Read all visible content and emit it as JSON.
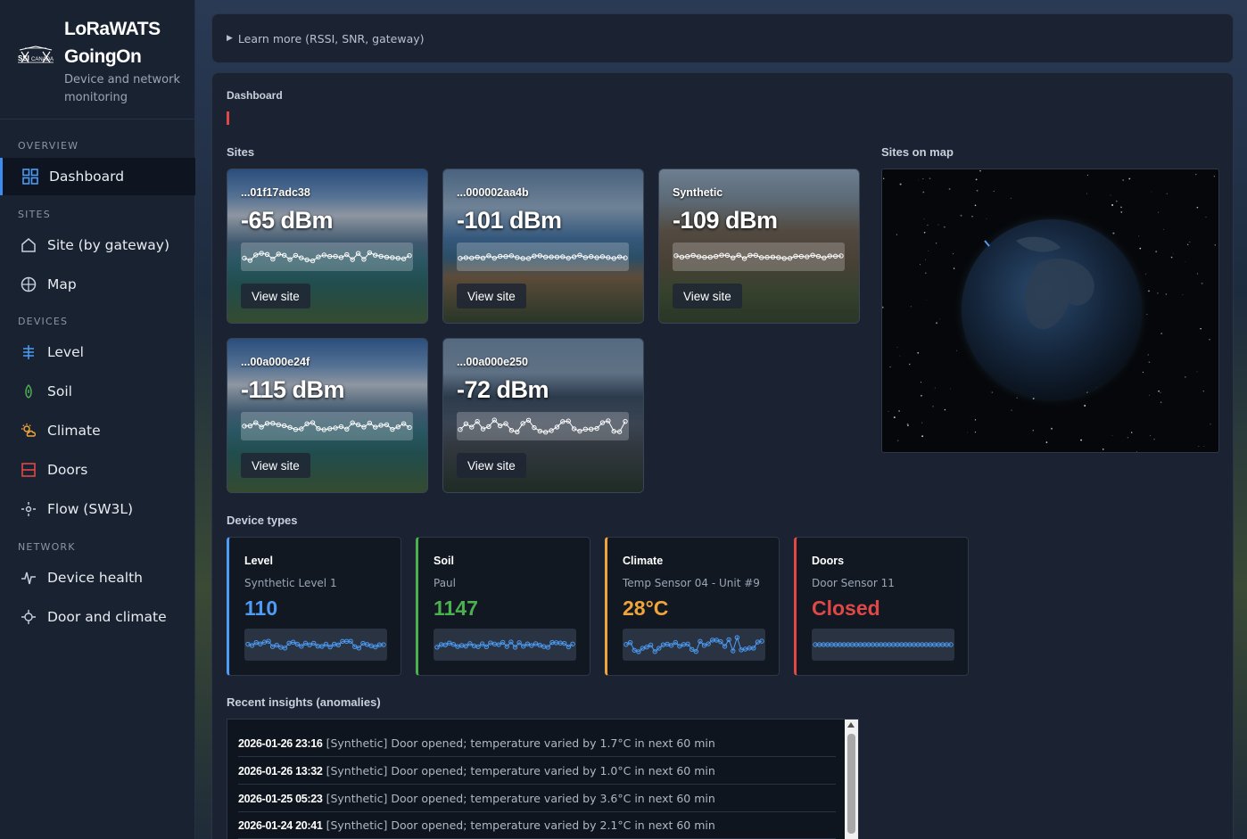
{
  "sidebar": {
    "brand_line1": "LoRaWATS",
    "brand_line2": "GoingOn",
    "subtitle": "Device and network monitoring",
    "sections": {
      "overview": "OVERVIEW",
      "sites": "SITES",
      "devices": "DEVICES",
      "network": "NETWORK"
    },
    "items": {
      "dashboard": "Dashboard",
      "site_by_gateway": "Site (by gateway)",
      "map": "Map",
      "level": "Level",
      "soil": "Soil",
      "climate": "Climate",
      "doors": "Doors",
      "flow": "Flow (SW3L)",
      "device_health": "Device health",
      "door_and_climate": "Door and climate"
    }
  },
  "learn_more": "Learn more (RSSI, SNR, gateway)",
  "dashboard": {
    "heading": "Dashboard",
    "sites_heading": "Sites",
    "map_heading": "Sites on map",
    "device_types_heading": "Device types",
    "insights_heading": "Recent insights (anomalies)"
  },
  "sites": [
    {
      "id": "...01f17adc38",
      "rssi": "-65 dBm",
      "button": "View site"
    },
    {
      "id": "...000002aa4b",
      "rssi": "-101 dBm",
      "button": "View site"
    },
    {
      "id": "Synthetic",
      "rssi": "-109 dBm",
      "button": "View site"
    },
    {
      "id": "...00a000e24f",
      "rssi": "-115 dBm",
      "button": "View site"
    },
    {
      "id": "...00a000e250",
      "rssi": "-72 dBm",
      "button": "View site"
    }
  ],
  "device_types": [
    {
      "title": "Level",
      "device": "Synthetic Level 1",
      "value": "110",
      "color": "#4d9cf5"
    },
    {
      "title": "Soil",
      "device": "Paul",
      "value": "1147",
      "color": "#4caf50"
    },
    {
      "title": "Climate",
      "device": "Temp Sensor 04 - Unit #9",
      "value": "28°C",
      "color": "#f0a43a"
    },
    {
      "title": "Doors",
      "device": "Door Sensor 11",
      "value": "Closed",
      "color": "#e04848"
    }
  ],
  "insights": [
    {
      "time": "2026-01-26 23:16",
      "text": "[Synthetic] Door opened; temperature varied by 1.7°C in next 60 min"
    },
    {
      "time": "2026-01-26 13:32",
      "text": "[Synthetic] Door opened; temperature varied by 1.0°C in next 60 min"
    },
    {
      "time": "2026-01-25 05:23",
      "text": "[Synthetic] Door opened; temperature varied by 3.6°C in next 60 min"
    },
    {
      "time": "2026-01-24 20:41",
      "text": "[Synthetic] Door opened; temperature varied by 2.1°C in next 60 min"
    }
  ]
}
